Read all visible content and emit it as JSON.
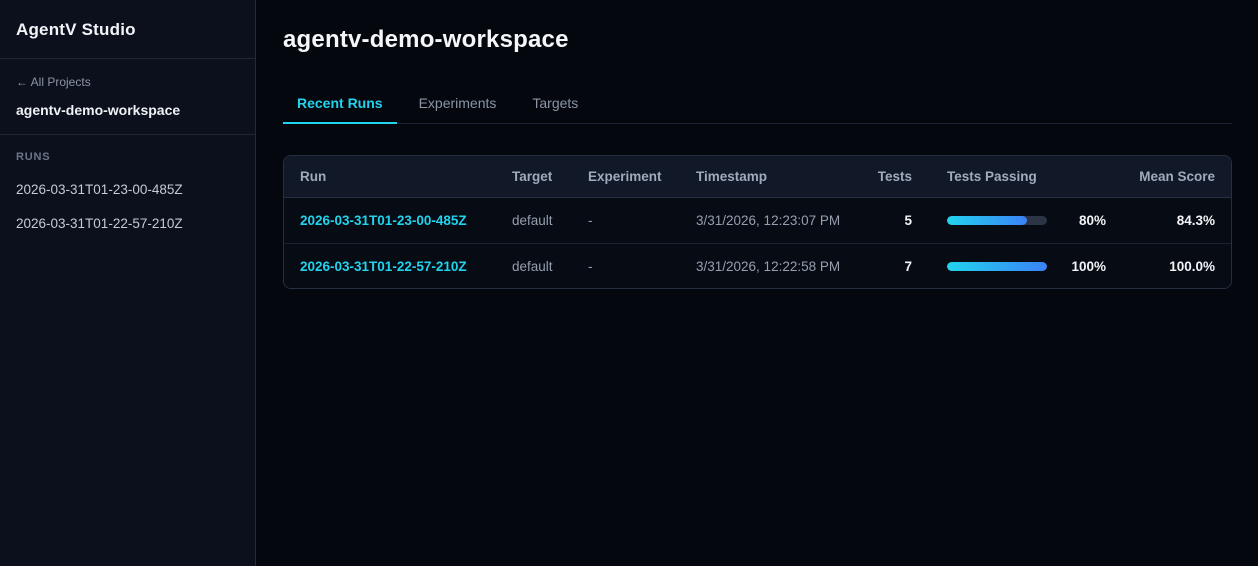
{
  "app": {
    "title": "AgentV Studio"
  },
  "sidebar": {
    "back_link": "← All Projects",
    "project_name": "agentv-demo-workspace",
    "runs_heading": "RUNS",
    "runs": [
      "2026-03-31T01-23-00-485Z",
      "2026-03-31T01-22-57-210Z"
    ]
  },
  "main": {
    "title": "agentv-demo-workspace",
    "tabs": [
      {
        "label": "Recent Runs",
        "active": true
      },
      {
        "label": "Experiments",
        "active": false
      },
      {
        "label": "Targets",
        "active": false
      }
    ]
  },
  "table": {
    "columns": [
      "Run",
      "Target",
      "Experiment",
      "Timestamp",
      "Tests",
      "Tests Passing",
      "Mean Score"
    ],
    "rows": [
      {
        "run": "2026-03-31T01-23-00-485Z",
        "target": "default",
        "experiment": "-",
        "timestamp": "3/31/2026, 12:23:07 PM",
        "tests": "5",
        "passing_value": 80,
        "passing_pct": "80%",
        "mean_score": "84.3%"
      },
      {
        "run": "2026-03-31T01-22-57-210Z",
        "target": "default",
        "experiment": "-",
        "timestamp": "3/31/2026, 12:22:58 PM",
        "tests": "7",
        "passing_value": 100,
        "passing_pct": "100%",
        "mean_score": "100.0%"
      }
    ]
  },
  "colors": {
    "accent": "#22d3ee",
    "progress_start": "#22d3ee",
    "progress_end": "#3b82f6",
    "progress_track": "#2b3545"
  }
}
